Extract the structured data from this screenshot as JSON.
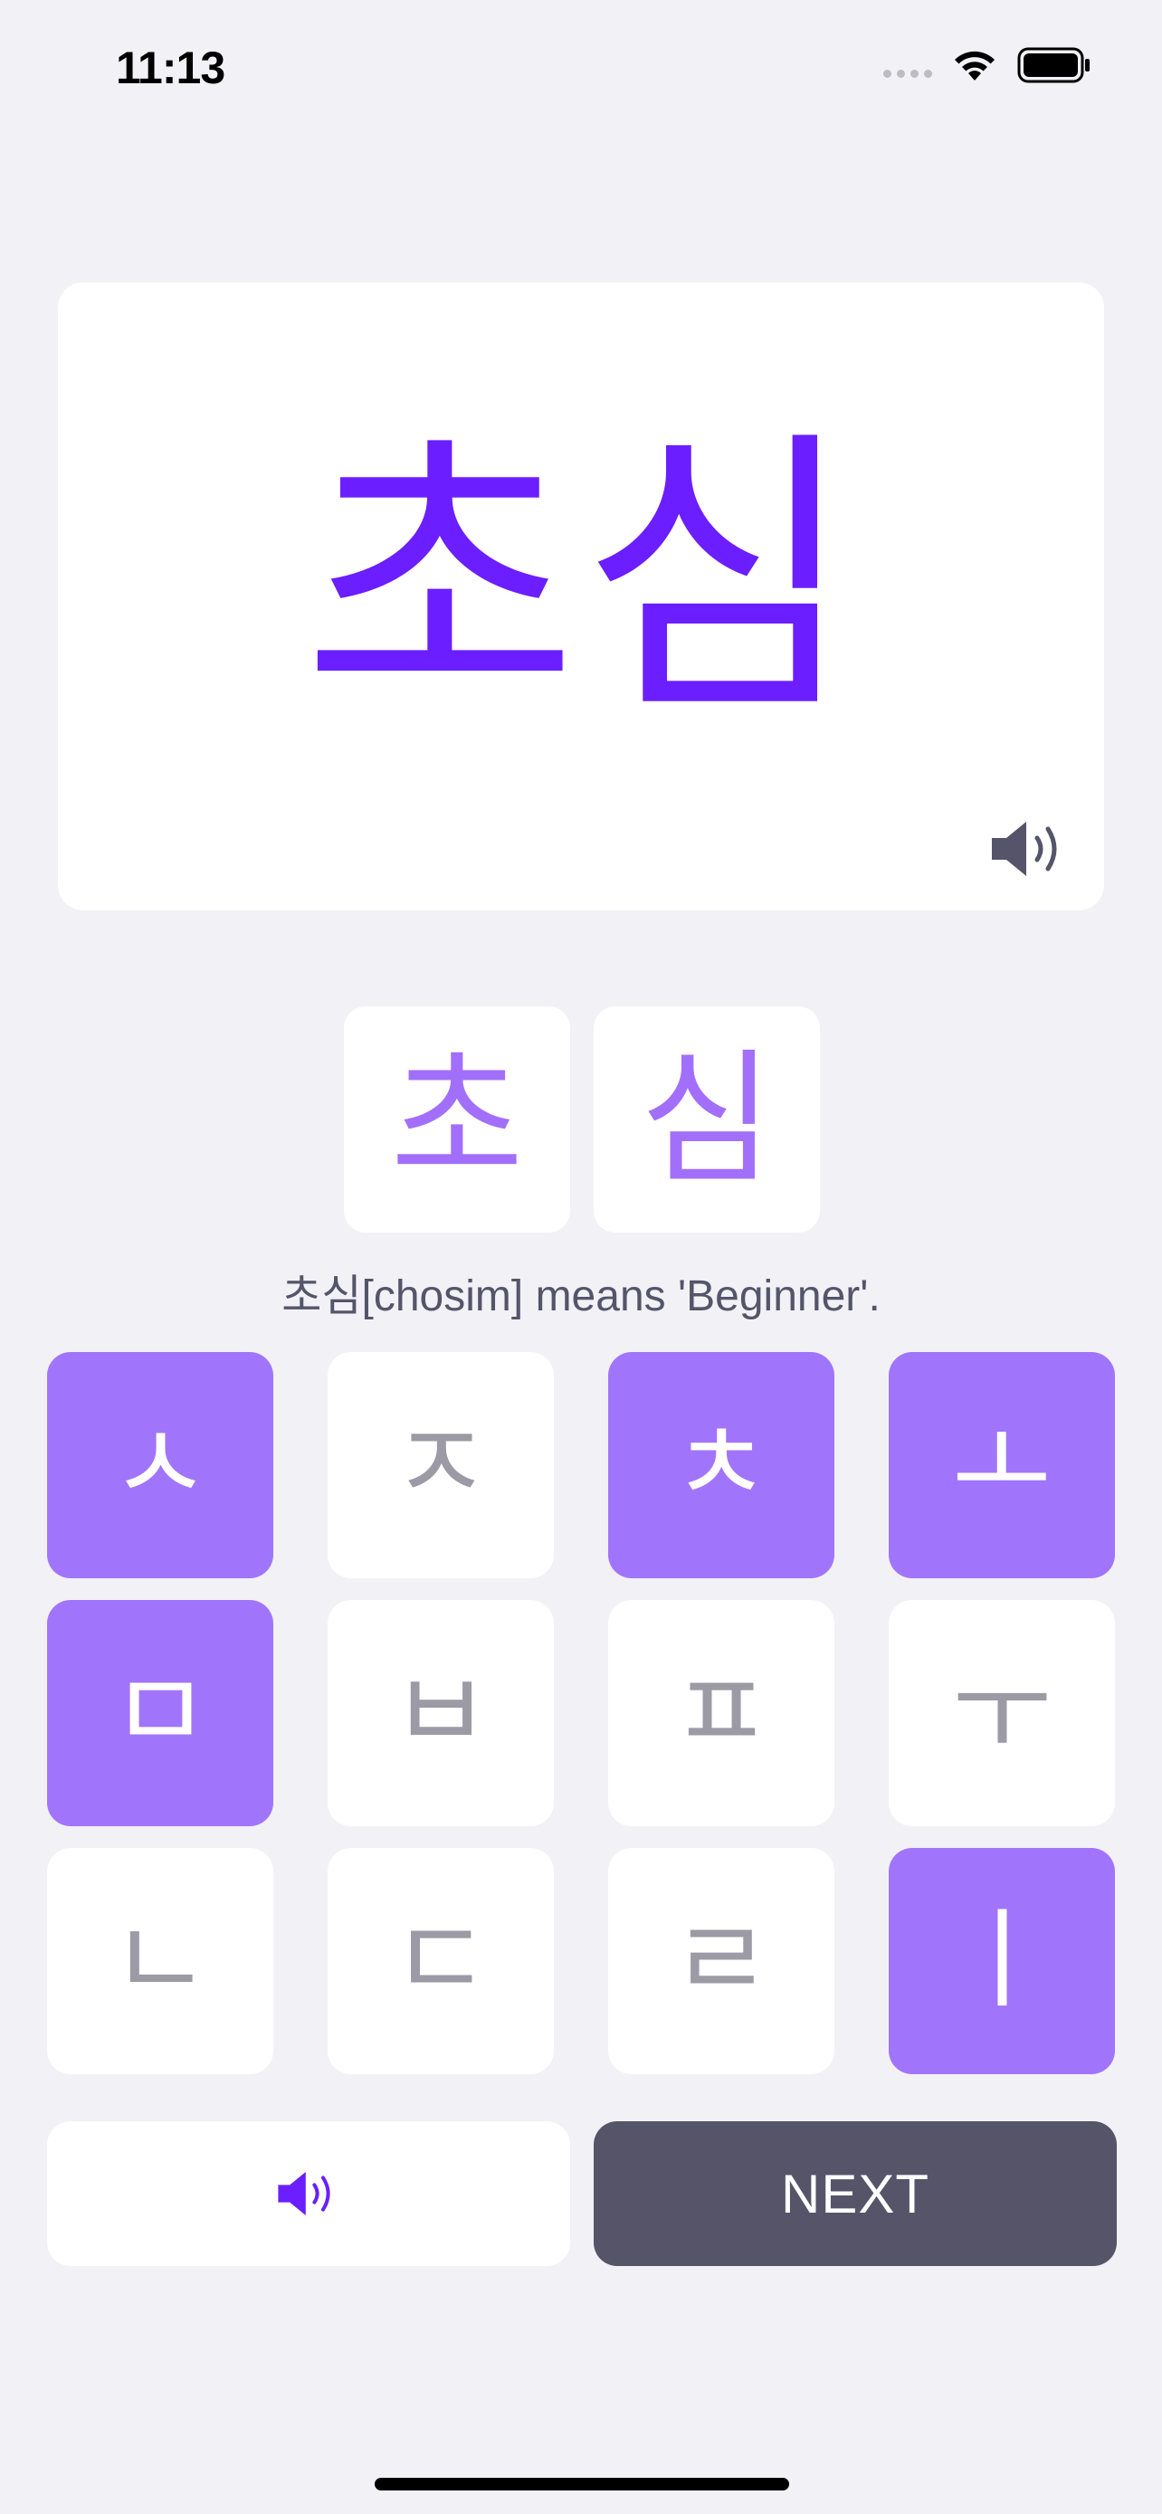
{
  "status_bar": {
    "time": "11:13",
    "icons": [
      "signal-icon",
      "wifi-icon",
      "battery-icon"
    ]
  },
  "card": {
    "word": "초심",
    "speaker_icon": "speaker-icon"
  },
  "syllables": [
    "초",
    "심"
  ],
  "meaning": "초심[chosim] means 'Beginner'.",
  "jamo_keys": [
    {
      "char": "ㅅ",
      "selected": true
    },
    {
      "char": "ㅈ",
      "selected": false
    },
    {
      "char": "ㅊ",
      "selected": true
    },
    {
      "char": "ㅗ",
      "selected": true
    },
    {
      "char": "ㅁ",
      "selected": true
    },
    {
      "char": "ㅂ",
      "selected": false
    },
    {
      "char": "ㅍ",
      "selected": false
    },
    {
      "char": "ㅜ",
      "selected": false
    },
    {
      "char": "ㄴ",
      "selected": false
    },
    {
      "char": "ㄷ",
      "selected": false
    },
    {
      "char": "ㄹ",
      "selected": false
    },
    {
      "char": "ㅣ",
      "selected": true
    }
  ],
  "actions": {
    "audio_icon": "speaker-icon",
    "next_label": "NEXT"
  },
  "colors": {
    "accent": "#6B1EFF",
    "selected_key": "#A175FB",
    "next_button": "#555468",
    "background": "#F2F1F6"
  }
}
